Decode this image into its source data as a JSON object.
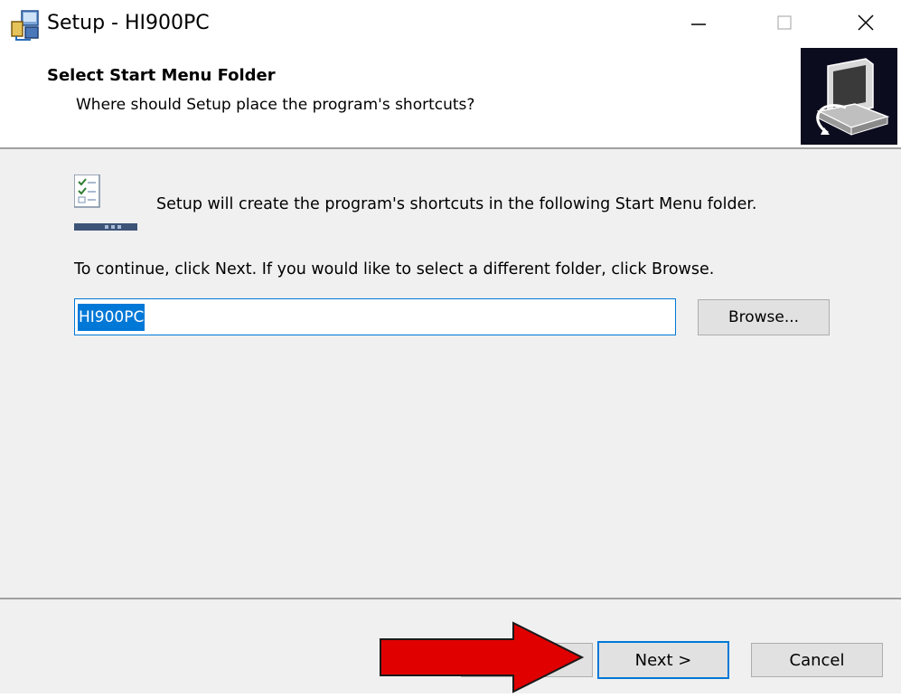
{
  "window": {
    "title": "Setup - HI900PC",
    "controls": {
      "minimize": "—",
      "maximize": "☐",
      "close": "✕"
    },
    "icon": "setup-installer-icon"
  },
  "header": {
    "title": "Select Start Menu Folder",
    "subtitle": "Where should Setup place the program's shortcuts?",
    "image_icon": "computer-install-icon"
  },
  "body": {
    "icon": "start-menu-folder-icon",
    "intro": "Setup will create the program's shortcuts in the following Start Menu folder.",
    "instructions": "To continue, click Next. If you would like to select a different folder, click Browse.",
    "folder_input": {
      "value": "HI900PC",
      "selected": true
    },
    "browse_label": "Browse..."
  },
  "footer": {
    "back_label": "",
    "next_label": "Next >",
    "cancel_label": "Cancel"
  },
  "annotation": {
    "icon": "red-arrow-icon",
    "color": "#e00000",
    "points_to": "next-button"
  },
  "colors": {
    "accent": "#0078d7",
    "dialog_bg": "#f0f0f0",
    "button_bg": "#e1e1e1"
  }
}
